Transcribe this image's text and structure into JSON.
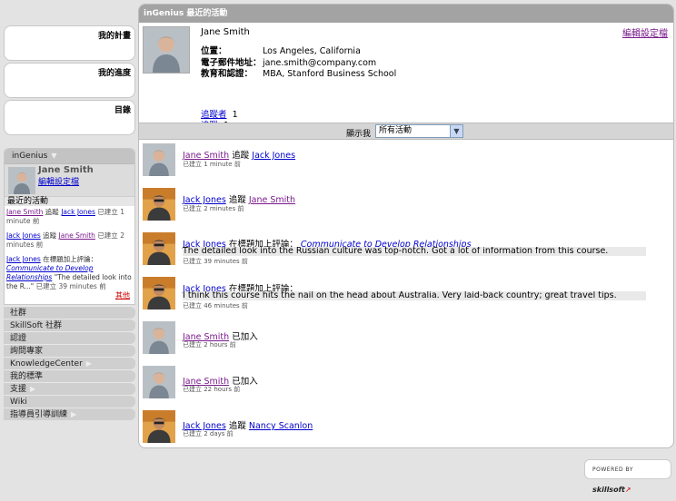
{
  "sidebar": {
    "plan_boxes": [
      "我的計畫",
      "我的進度",
      "目錄"
    ],
    "ingenius_title": "inGenius",
    "profile_name": "Jane Smith",
    "profile_edit": "編輯設定檔",
    "recent_title": "最近的活動",
    "mini_activities": [
      {
        "a": "Jane Smith",
        "verb": "追蹤",
        "b": "Jack Jones",
        "time": "已建立 1 minute 前"
      },
      {
        "a": "Jack Jones",
        "verb": "追蹤",
        "b": "Jane Smith",
        "time": "已建立 2 minutes 前"
      },
      {
        "a": "Jack Jones",
        "verb": "在標題加上評論：",
        "b": "Communicate to Develop Relationships",
        "extra": "\"The detailed look into the R...\"",
        "time": "已建立 39 minutes 前"
      }
    ],
    "more": "其他",
    "nav": [
      "社群",
      "SkillSoft 社群",
      "認證",
      "詢問專家",
      "KnowledgeCenter",
      "我的標準",
      "支援",
      "Wiki",
      "指導員引導訓練"
    ]
  },
  "main": {
    "header": "inGenius 最近的活動",
    "profile": {
      "name": "Jane  Smith",
      "edit": "編輯設定檔",
      "location_label": "位置：",
      "location": "Los Angeles, California",
      "email_label": "電子郵件地址：",
      "email": "jane.smith@company.com",
      "edu_label": "教育和認證：",
      "edu": "MBA, Stanford Business School",
      "followers_label": "追蹤者",
      "followers_count": "1",
      "following_label": "追蹤",
      "following_count": "1"
    },
    "filter": {
      "label": "顯示我",
      "value": "所有活動"
    },
    "feed": [
      {
        "actor": "Jane Smith",
        "verb": "追蹤",
        "target": "Jack Jones",
        "comment": "",
        "time": "已建立 1 minute 前"
      },
      {
        "actor": "Jack Jones",
        "verb": "追蹤",
        "target": "Jane Smith",
        "comment": "",
        "time": "已建立 2 minutes 前"
      },
      {
        "actor": "Jack Jones",
        "verb": "在標題加上評論：",
        "target": "Communicate to Develop Relationships",
        "comment": "The detailed look into the Russian culture was top-notch. Got a lot of information from this course.",
        "time": "已建立 39 minutes 前"
      },
      {
        "actor": "Jack Jones",
        "verb": "在標題加上評論：",
        "target": "",
        "comment": "I think this course hits the nail on the head about Australia. Very laid-back country; great travel tips.",
        "time": "已建立 46 minutes 前"
      },
      {
        "actor": "Jane Smith",
        "verb": "已加入",
        "target": "",
        "comment": "",
        "time": "已建立 2 hours 前"
      },
      {
        "actor": "Jane Smith",
        "verb": "已加入",
        "target": "",
        "comment": "",
        "time": "已建立 22 hours 前"
      },
      {
        "actor": "Jack Jones",
        "verb": "追蹤",
        "target": "Nancy Scanlon",
        "comment": "",
        "time": "已建立 2 days 前"
      }
    ]
  },
  "powered": {
    "by": "POWERED BY",
    "brand": "skillsoft"
  },
  "colors": {
    "header_gray": "#a3a3a3",
    "link": "#0000cc",
    "visited": "#7a1a8c",
    "more_red": "#cc0000"
  }
}
